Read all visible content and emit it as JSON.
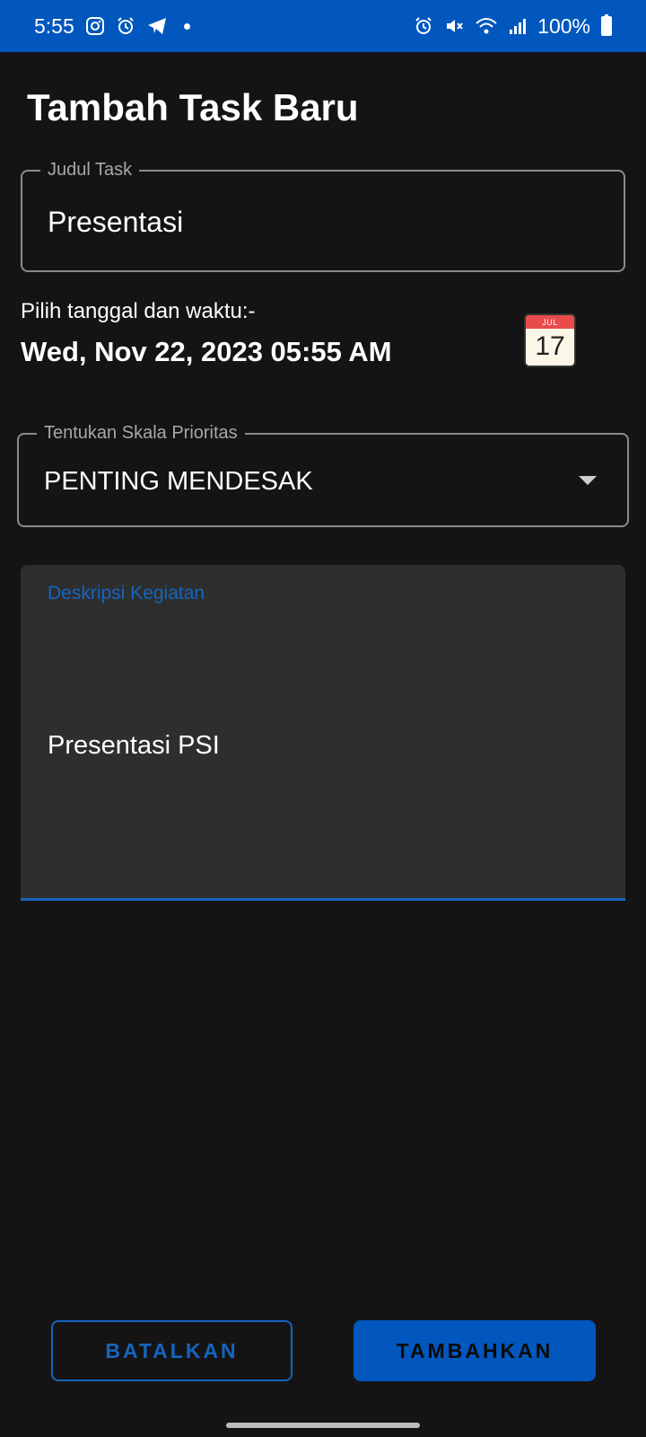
{
  "status_bar": {
    "time": "5:55",
    "battery": "100%",
    "left_icons": [
      "instagram-icon",
      "alarm-icon",
      "telegram-icon"
    ],
    "right_icons": [
      "alarm-icon",
      "mute-icon",
      "wifi-icon",
      "signal-icon",
      "battery-icon"
    ]
  },
  "page": {
    "title": "Tambah Task Baru"
  },
  "task_title": {
    "label": "Judul Task",
    "value": "Presentasi"
  },
  "datetime": {
    "prompt": "Pilih tanggal dan waktu:-",
    "value": "Wed, Nov 22, 2023 05:55 AM",
    "calendar_icon": {
      "month": "JUL",
      "day": "17"
    }
  },
  "priority": {
    "label": "Tentukan Skala Prioritas",
    "value": "PENTING MENDESAK"
  },
  "description": {
    "label": "Deskripsi Kegiatan",
    "value": "Presentasi PSI"
  },
  "actions": {
    "cancel_label": "BATALKAN",
    "add_label": "TAMBAHKAN"
  },
  "colors": {
    "accent": "#0157bd",
    "background": "#141414",
    "field_fill": "#2e2e2e",
    "focus": "#1565c0"
  }
}
